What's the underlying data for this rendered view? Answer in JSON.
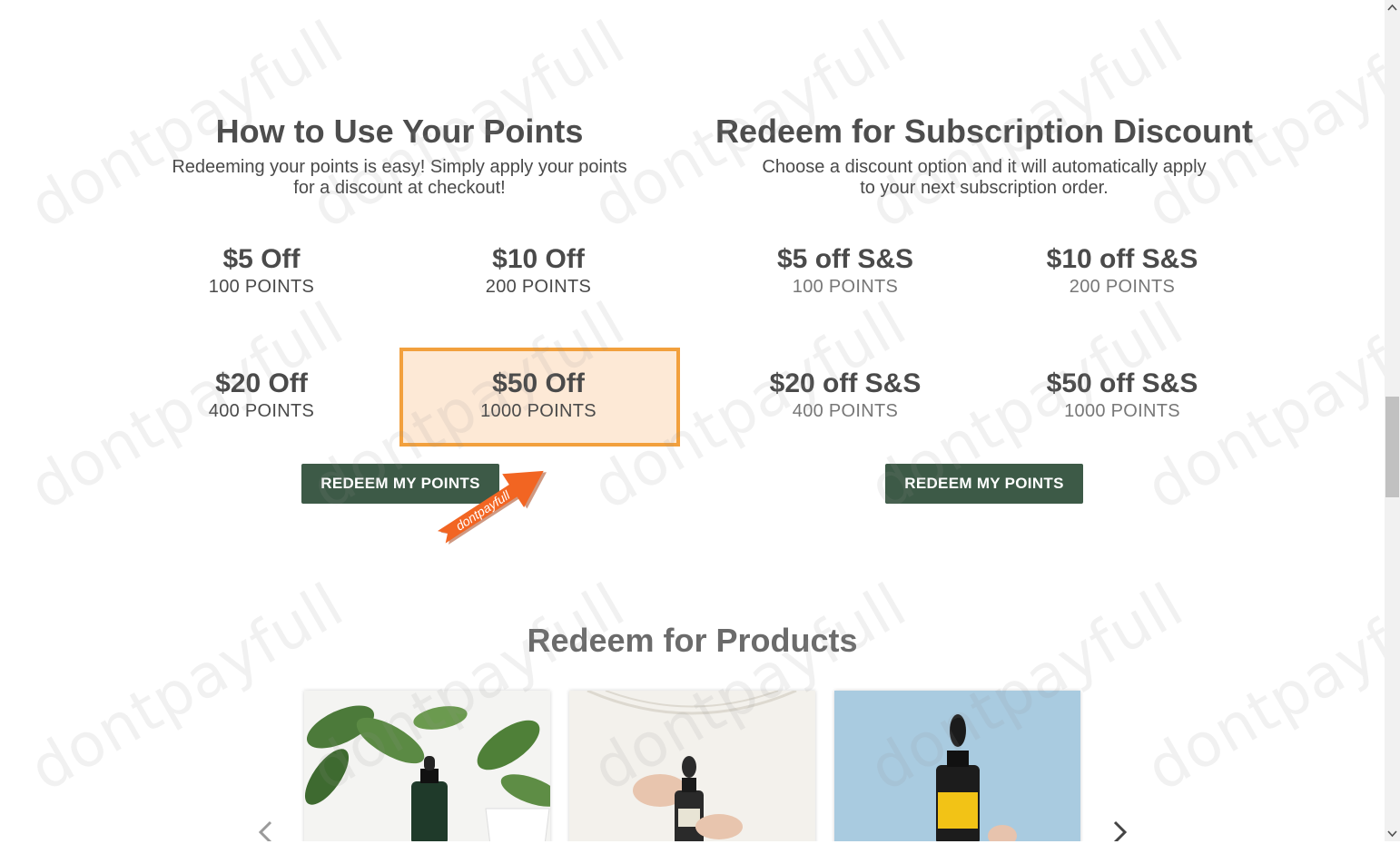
{
  "points_section": {
    "title": "How to Use Your Points",
    "subtitle_line1": "Redeeming your points is easy! Simply apply your points",
    "subtitle_line2": "for a discount at checkout!",
    "tiers": [
      {
        "amount": "$5 Off",
        "points": "100 POINTS"
      },
      {
        "amount": "$10 Off",
        "points": "200 POINTS"
      },
      {
        "amount": "$20 Off",
        "points": "400 POINTS"
      },
      {
        "amount": "$50 Off",
        "points": "1000 POINTS"
      }
    ],
    "button_label": "REDEEM MY POINTS"
  },
  "subscription_section": {
    "title": "Redeem for Subscription Discount",
    "subtitle_line1": "Choose a discount option and it will automatically apply",
    "subtitle_line2": "to your next subscription order.",
    "tiers": [
      {
        "amount": "$5 off S&S",
        "points": "100 POINTS"
      },
      {
        "amount": "$10 off S&S",
        "points": "200 POINTS"
      },
      {
        "amount": "$20 off S&S",
        "points": "400 POINTS"
      },
      {
        "amount": "$50 off S&S",
        "points": "1000 POINTS"
      }
    ],
    "button_label": "REDEEM MY POINTS"
  },
  "products_section": {
    "title": "Redeem for Products",
    "prev_icon": "chevron-left-icon",
    "next_icon": "chevron-right-icon",
    "cards": [
      {
        "image": "dropper-bottle-with-plants"
      },
      {
        "image": "hand-holding-zinc-dropper"
      },
      {
        "image": "omega-3-6-7-9-bottle-on-blue"
      }
    ]
  },
  "overlay": {
    "arrow_label": "dontpayfull",
    "watermark_text": "dontpayfull"
  },
  "colors": {
    "button": "#3d5a47",
    "highlight_border": "#f2a03d",
    "highlight_fill": "#fde9d6",
    "arrow": "#f26522"
  }
}
